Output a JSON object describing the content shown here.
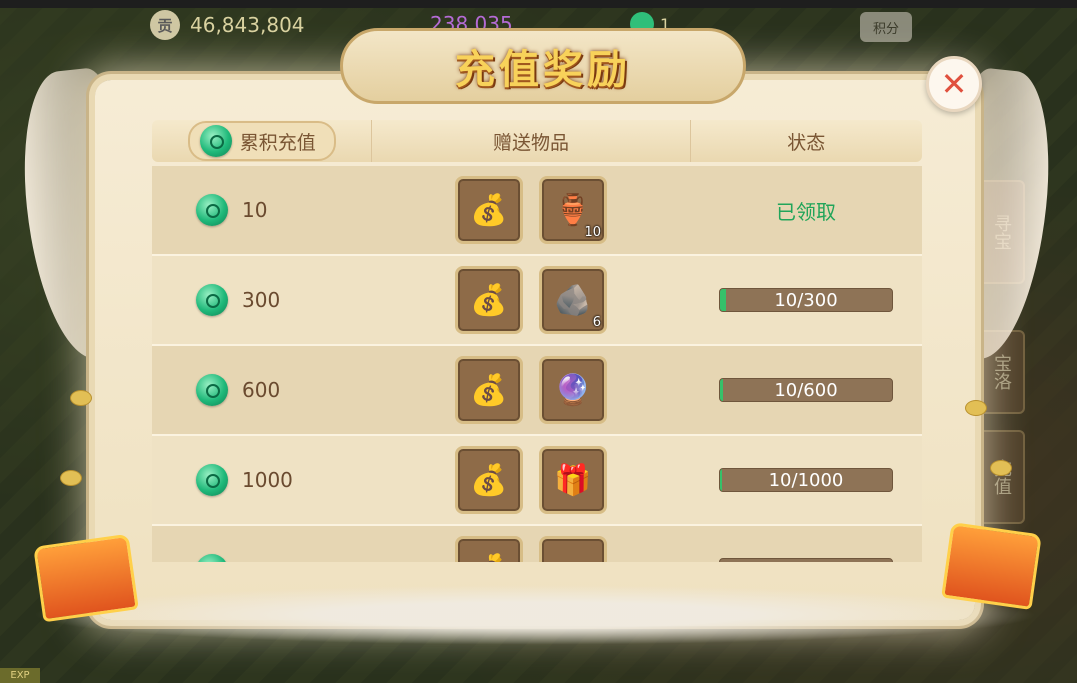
{
  "hud": {
    "currency_icon": "贡",
    "currency_value": "46,843,804",
    "secondary_value": "238,035",
    "tertiary_value": "1",
    "score_button": "积分"
  },
  "side_tabs": [
    "寻宝",
    "宝洛",
    "充值"
  ],
  "dialog": {
    "title": "充值奖励",
    "close_icon": "✕",
    "headers": {
      "cumulative": "累积充值",
      "gifts": "赠送物品",
      "status": "状态"
    },
    "rows": [
      {
        "amount": "10",
        "items": [
          {
            "icon": "money-bag-icon",
            "glyph": "💰",
            "count": ""
          },
          {
            "icon": "vase-icon",
            "glyph": "🏺",
            "count": "10"
          }
        ],
        "status": "已领取",
        "progress": null
      },
      {
        "amount": "300",
        "items": [
          {
            "icon": "money-bag-icon",
            "glyph": "💰",
            "count": ""
          },
          {
            "icon": "ore-icon",
            "glyph": "🪨",
            "count": "6"
          }
        ],
        "status": "10/300",
        "progress": 0.033
      },
      {
        "amount": "600",
        "items": [
          {
            "icon": "money-bag-icon",
            "glyph": "💰",
            "count": ""
          },
          {
            "icon": "crystal-ball-icon",
            "glyph": "🔮",
            "count": ""
          }
        ],
        "status": "10/600",
        "progress": 0.017
      },
      {
        "amount": "1000",
        "items": [
          {
            "icon": "money-bag-icon",
            "glyph": "💰",
            "count": ""
          },
          {
            "icon": "gift-bag-icon",
            "glyph": "🎁",
            "count": ""
          }
        ],
        "status": "10/1000",
        "progress": 0.01
      },
      {
        "amount": "",
        "items": [
          {
            "icon": "money-bag-icon",
            "glyph": "💰",
            "count": ""
          },
          {
            "icon": "red-bag-icon",
            "glyph": "👝",
            "count": ""
          }
        ],
        "status": "",
        "progress": null
      }
    ]
  },
  "exp_label": "EXP",
  "colors": {
    "claimed": "#21a55a",
    "title": "#f8d25a",
    "close": "#e0503e"
  }
}
